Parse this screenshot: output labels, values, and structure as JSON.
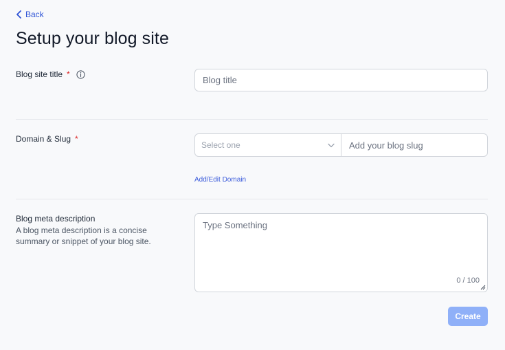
{
  "nav": {
    "back_label": "Back"
  },
  "page": {
    "title": "Setup your blog site"
  },
  "blog_title": {
    "label": "Blog site title",
    "required_mark": "*",
    "placeholder": "Blog title"
  },
  "domain": {
    "label": "Domain & Slug",
    "required_mark": "*",
    "select_placeholder": "Select one",
    "slug_placeholder": "Add your blog slug",
    "add_edit_label": "Add/Edit Domain"
  },
  "meta": {
    "label": "Blog meta description",
    "helper": "A blog meta description is a concise summary or snippet of your blog site.",
    "placeholder": "Type Something",
    "counter": "0 / 100"
  },
  "actions": {
    "create_label": "Create"
  },
  "colors": {
    "accent": "#2f54d6",
    "required": "#dc2626",
    "button_disabled": "#8fb0f8"
  }
}
